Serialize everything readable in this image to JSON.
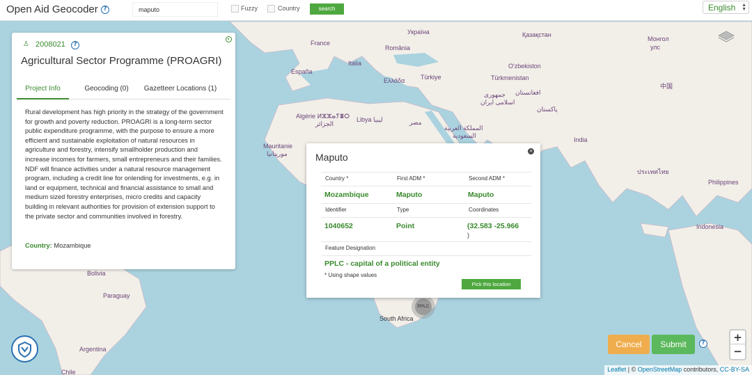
{
  "header": {
    "app_title": "Open Aid Geocoder",
    "search_value": "maputo",
    "fuzzy_label": "Fuzzy",
    "country_label": "Country",
    "search_button": "search",
    "language": "English"
  },
  "project": {
    "id": "2008021",
    "title": "Agricultural Sector Programme (PROAGRI)",
    "tabs": [
      {
        "label": "Project Info"
      },
      {
        "label": "Geocoding (0)"
      },
      {
        "label": "Gazetteer Locations (1)"
      }
    ],
    "description": "Rural development has high priority in the strategy of the government for growth and poverty reduction. PROAGRI is a long-term sector public expenditure programme, with the purpose to ensure a more efficient and sustainable exploitation of natural resources in agriculture and forestry, intensify smallholder production and increase incomes for farmers, small entrepreneurs and their families. NDF will finance activities under a natural resource management program, including a credit line for onlending for investments, e.g. in land or equipment, technical and financial assistance to small and medium sized forestry enterprises, micro credits and capacity building in relevant authorities for provision of extension support to the private sector and communities involved in forestry.",
    "country_label": "Country:",
    "country_value": "Mozambique"
  },
  "popup": {
    "title": "Maputo",
    "headers_row1": [
      "Country *",
      "First ADM *",
      "Second ADM *"
    ],
    "values_row1": [
      "Mozambique",
      "Maputo",
      "Maputo"
    ],
    "headers_row2": [
      "Identifier",
      "Type",
      "Coordinates"
    ],
    "values_row2": [
      "1040652",
      "Point",
      "(32.583 -25.966"
    ],
    "coord_close": ")",
    "feature_header": "Feature Designation",
    "feature_value": "PPLC - capital of a political entity",
    "note": "* Using shape values",
    "pick_button": "Pick this location"
  },
  "marker": {
    "label": "PPLC"
  },
  "actions": {
    "cancel": "Cancel",
    "submit": "Submit"
  },
  "zoom": {
    "in": "+",
    "out": "−"
  },
  "attribution": {
    "leaflet": "Leaflet",
    "sep": " | © ",
    "osm": "OpenStreetMap",
    "contrib": " contributors, ",
    "license": "CC-BY-SA"
  },
  "map_labels": [
    {
      "text": "Україна"
    },
    {
      "text": "Қазақстан"
    },
    {
      "text": "Монгол"
    },
    {
      "text": "улс"
    },
    {
      "text": "France"
    },
    {
      "text": "România"
    },
    {
      "text": "O'zbekiston"
    },
    {
      "text": "Italia"
    },
    {
      "text": "España"
    },
    {
      "text": "Türkiye"
    },
    {
      "text": "Türkmenistan"
    },
    {
      "text": "中国"
    },
    {
      "text": "Ελλάδα"
    },
    {
      "text": "افغانستان"
    },
    {
      "text": "جمهوری"
    },
    {
      "text": "اسلامی ایران"
    },
    {
      "text": "Algérie ⵍⵣⵣⴰⵢⴻⵔ"
    },
    {
      "text": "الجزائر"
    },
    {
      "text": "Libya ليبيا"
    },
    {
      "text": "مصر"
    },
    {
      "text": "پاکستان"
    },
    {
      "text": "المملكة العربية"
    },
    {
      "text": "السعودية"
    },
    {
      "text": "India"
    },
    {
      "text": "Mauritanie"
    },
    {
      "text": "موريتانيا"
    },
    {
      "text": "ประเทศไทย"
    },
    {
      "text": "Philippines"
    },
    {
      "text": "Indonesia"
    },
    {
      "text": "Bolivia"
    },
    {
      "text": "Paraguay"
    },
    {
      "text": "South Africa"
    },
    {
      "text": "Argentina"
    },
    {
      "text": "Chile"
    }
  ]
}
